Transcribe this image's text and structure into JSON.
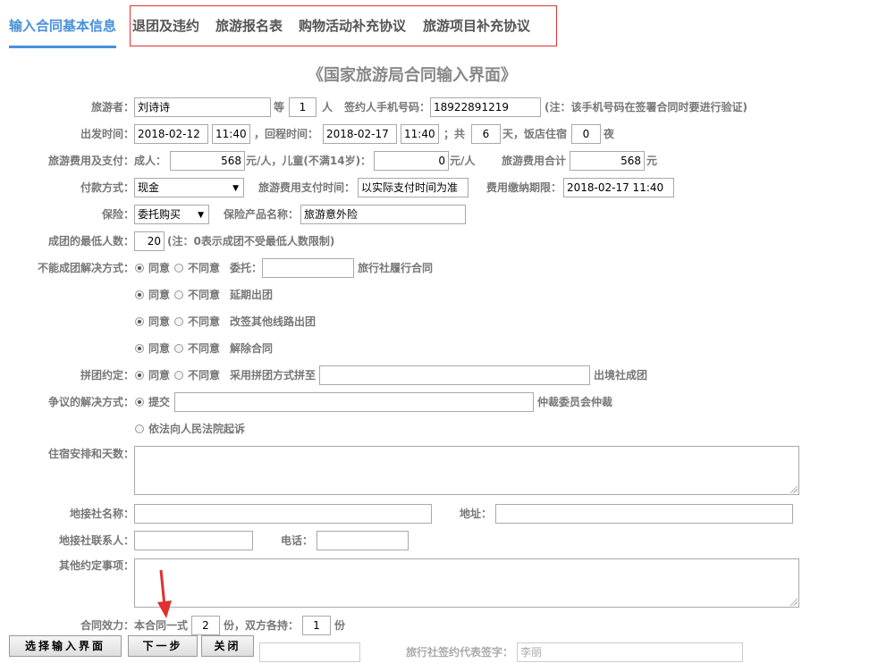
{
  "tabs": [
    {
      "label": "输入合同基本信息"
    },
    {
      "label": "退团及违约"
    },
    {
      "label": "旅游报名表"
    },
    {
      "label": "购物活动补充协议"
    },
    {
      "label": "旅游项目补充协议"
    }
  ],
  "page_title": "《国家旅游局合同输入界面》",
  "traveler": {
    "label": "旅游者：",
    "name": "刘诗诗",
    "deng": "等",
    "count": "1",
    "ren": "人",
    "phone_label": "签约人手机号码：",
    "phone": "18922891219",
    "phone_note": "(注：该手机号码在签署合同时要进行验证)"
  },
  "dates": {
    "depart_label": "出发时间：",
    "depart_date": "2018-02-12",
    "depart_time": "11:40",
    "return_label": "，回程时间：",
    "return_date": "2018-02-17",
    "return_time": "11:40",
    "gong": "；共",
    "days": "6",
    "tian_hotel": "天，饭店住宿",
    "nights": "0",
    "ye": "夜"
  },
  "fee": {
    "label": "旅游费用及支付：",
    "adult_label": "成人：",
    "adult": "568",
    "adult_unit": "元/人，儿童(不满14岁)：",
    "child": "0",
    "child_unit": "元/人",
    "total_label": "旅游费用合计",
    "total": "568",
    "total_unit": "元"
  },
  "payment": {
    "method_label": "付款方式：",
    "method": "现金",
    "pay_time_label": "旅游费用支付时间：",
    "pay_time": "以实际支付时间为准",
    "deadline_label": "费用缴纳期限：",
    "deadline": "2018-02-17 11:40"
  },
  "insurance": {
    "label": "保险：",
    "value": "委托购买",
    "product_label": "保险产品名称：",
    "product": "旅游意外险"
  },
  "min_group": {
    "label": "成团的最低人数：",
    "value": "20",
    "note": "(注：0表示成团不受最低人数限制)"
  },
  "no_group": {
    "label": "不能成团解决方式：",
    "agree": "同意",
    "disagree": "不同意",
    "row1_a": "委托：",
    "row1_b": "旅行社履行合同",
    "row2": "延期出团",
    "row3": "改签其他线路出团",
    "row4": "解除合同"
  },
  "pin": {
    "label": "拼团约定：",
    "agree": "同意",
    "disagree": "不同意",
    "a": "采用拼团方式拼至",
    "b": "出境社成团"
  },
  "dispute": {
    "label": "争议的解决方式：",
    "submit": "提交",
    "arbitration": "仲裁委员会仲裁",
    "court": "依法向人民法院起诉"
  },
  "lodging": {
    "label": "住宿安排和天数："
  },
  "local_agency": {
    "name_label": "地接社名称：",
    "address_label": "地址：",
    "contact_label": "地接社联系人：",
    "phone_label": "电话："
  },
  "other": {
    "label": "其他约定事项："
  },
  "validity": {
    "label": "合同效力：",
    "a": "本合同一式",
    "copies": "2",
    "b": "份，双方各持：",
    "each": "1",
    "c": "份"
  },
  "signature": {
    "label": "旅行社签约代表签字：",
    "placeholder": "李丽"
  },
  "buttons": {
    "select": "选择输入界面",
    "next": "下一步",
    "close": "关闭"
  },
  "colors": {
    "accent": "#4a90d9",
    "highlight_box": "#e03030",
    "arrow": "#e03030"
  }
}
